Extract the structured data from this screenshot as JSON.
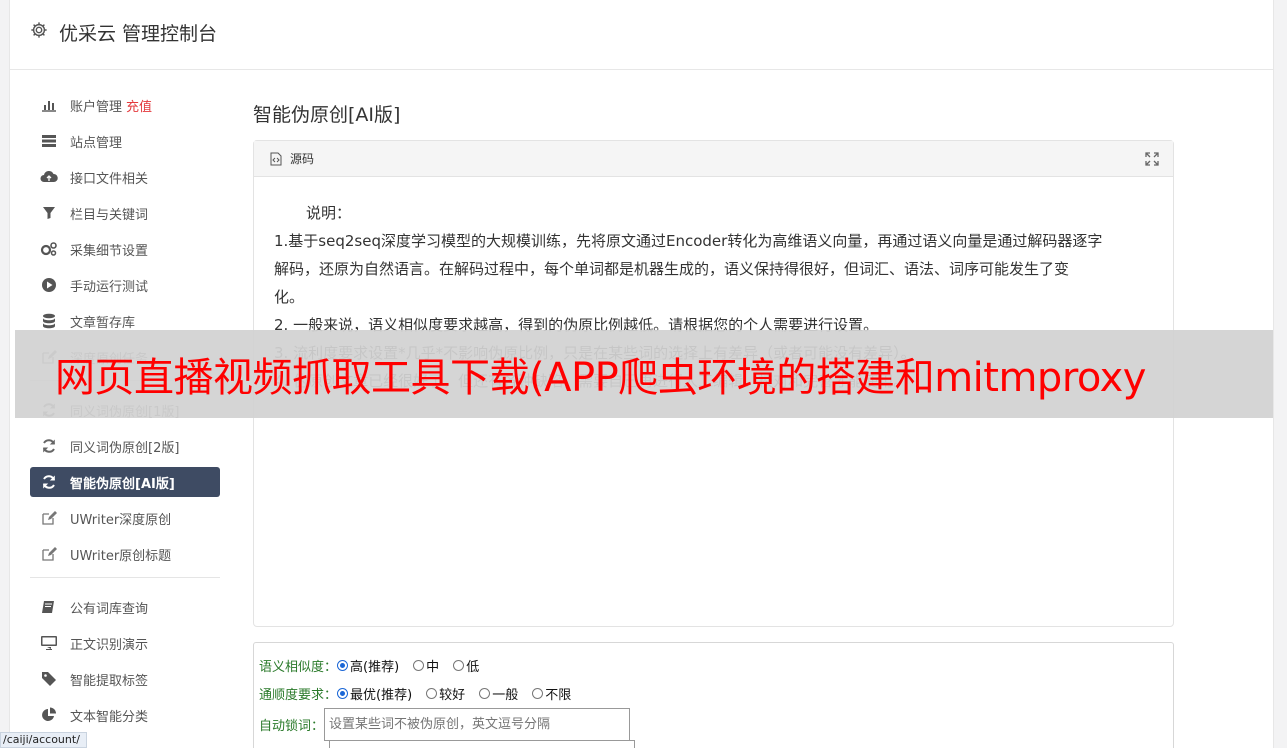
{
  "app": {
    "title": "优采云 管理控制台"
  },
  "sidebar": {
    "items": [
      {
        "label": "账户管理",
        "extra": "充值",
        "icon": "bar-chart-icon"
      },
      {
        "label": "站点管理",
        "icon": "server-icon"
      },
      {
        "label": "接口文件相关",
        "icon": "cloud-upload-icon"
      },
      {
        "label": "栏目与关键词",
        "icon": "filter-icon"
      },
      {
        "label": "采集细节设置",
        "icon": "gears-icon"
      },
      {
        "label": "手动运行测试",
        "icon": "play-circle-icon"
      },
      {
        "label": "文章暂存库",
        "icon": "database-icon"
      },
      {
        "label": "深度原创任务",
        "icon": "edit-icon"
      },
      {
        "label": "同义词伪原创[1版]",
        "icon": "refresh-icon"
      },
      {
        "label": "同义词伪原创[2版]",
        "icon": "refresh-icon"
      },
      {
        "label": "智能伪原创[AI版]",
        "icon": "refresh-icon",
        "active": true
      },
      {
        "label": "UWriter深度原创",
        "icon": "edit-icon"
      },
      {
        "label": "UWriter原创标题",
        "icon": "edit-icon"
      },
      {
        "label": "公有词库查询",
        "icon": "book-icon"
      },
      {
        "label": "正文识别演示",
        "icon": "desktop-icon"
      },
      {
        "label": "智能提取标签",
        "icon": "tag-icon"
      },
      {
        "label": "文本智能分类",
        "icon": "pie-chart-icon"
      }
    ]
  },
  "main": {
    "page_title": "智能伪原创[AI版]",
    "panel": {
      "source_label": "源码",
      "lines": [
        "说明：",
        "1.基于seq2seq深度学习模型的大规模训练，先将原文通过Encoder转化为高维语义向量，再通过语义向量是通过解码器逐字",
        "解码，还原为自然语言。在解码过程中，每个单词都是机器生成的，语义保持得很好，但词汇、语法、词序可能发生了变",
        "化。",
        "2. 一般来说，语义相似度要求越高，得到的伪原比例越低。请根据您的个人需要进行设置。",
        "3. 流利度要求设置*几乎*不影响伪原比例，只是在某些词的选择上有差异（或者可能没有差异）。",
        "4. 伪原创文章已经很好了，但还有各种缺陷，需要自己再进行人工编辑、校对和完善才能使用。"
      ]
    },
    "options": {
      "similarity": {
        "label": "语义相似度：",
        "choices": [
          "高(推荐)",
          "中",
          "低"
        ],
        "selected": 0
      },
      "fluency": {
        "label": "通顺度要求：",
        "choices": [
          "最优(推荐)",
          "较好",
          "一般",
          "不限"
        ],
        "selected": 0
      },
      "lock": {
        "label": "自动锁词：",
        "placeholder": "设置某些词不被伪原创，英文逗号分隔"
      }
    }
  },
  "overlay": {
    "banner_text": "网页直播视频抓取工具下载(APP爬虫环境的搭建和mitmproxy"
  },
  "status": {
    "url": "/caiji/account/"
  }
}
